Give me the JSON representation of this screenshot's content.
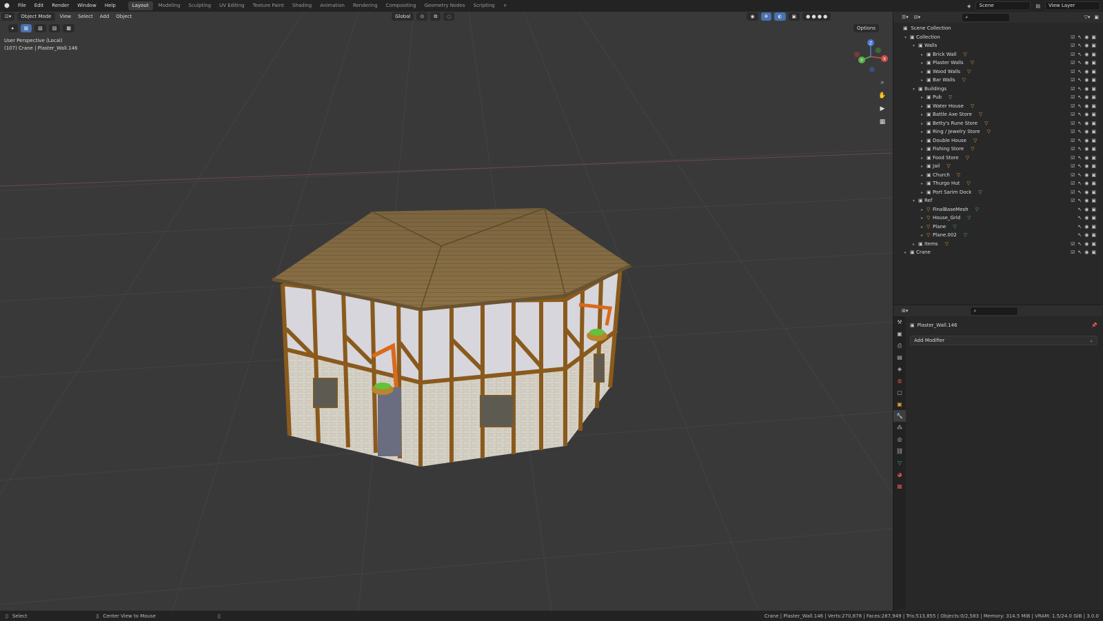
{
  "app": {
    "menu": [
      "File",
      "Edit",
      "Render",
      "Window",
      "Help"
    ],
    "workspaces": [
      "Layout",
      "Modeling",
      "Sculpting",
      "UV Editing",
      "Texture Paint",
      "Shading",
      "Animation",
      "Rendering",
      "Compositing",
      "Geometry Nodes",
      "Scripting",
      "+"
    ],
    "active_workspace": "Layout",
    "scene": "Scene",
    "view_layer": "View Layer"
  },
  "viewport": {
    "mode": "Object Mode",
    "menus": [
      "View",
      "Select",
      "Add",
      "Object"
    ],
    "orientation": "Global",
    "options_label": "Options",
    "overlay_line1": "User Perspective (Local)",
    "overlay_line2": "(107) Crane | Plaster_Wall.146",
    "axes": {
      "z": "Z",
      "x": "X",
      "y": "Y"
    }
  },
  "outliner": {
    "title": "Scene Collection",
    "rows": [
      {
        "name": "Collection",
        "depth": 1,
        "type": "collection",
        "open": true
      },
      {
        "name": "Walls",
        "depth": 2,
        "type": "collection",
        "open": true
      },
      {
        "name": "Brick Wall",
        "depth": 3,
        "type": "collection"
      },
      {
        "name": "Plaster Walls",
        "depth": 3,
        "type": "collection"
      },
      {
        "name": "Wood Walls",
        "depth": 3,
        "type": "collection"
      },
      {
        "name": "Bar Walls",
        "depth": 3,
        "type": "collection"
      },
      {
        "name": "Buildings",
        "depth": 2,
        "type": "collection",
        "open": true
      },
      {
        "name": "Pub",
        "depth": 3,
        "type": "collection"
      },
      {
        "name": "Water House",
        "depth": 3,
        "type": "collection"
      },
      {
        "name": "Battle Axe Store",
        "depth": 3,
        "type": "collection"
      },
      {
        "name": "Betty's Rune Store",
        "depth": 3,
        "type": "collection"
      },
      {
        "name": "Ring / Jewelry Store",
        "depth": 3,
        "type": "collection"
      },
      {
        "name": "Double House",
        "depth": 3,
        "type": "collection"
      },
      {
        "name": "Fishing Store",
        "depth": 3,
        "type": "collection"
      },
      {
        "name": "Food Store",
        "depth": 3,
        "type": "collection"
      },
      {
        "name": "Jail",
        "depth": 3,
        "type": "collection"
      },
      {
        "name": "Church",
        "depth": 3,
        "type": "collection"
      },
      {
        "name": "Thurgo Hut",
        "depth": 3,
        "type": "collection"
      },
      {
        "name": "Port Sarim Dock",
        "depth": 3,
        "type": "collection"
      },
      {
        "name": "Ref",
        "depth": 2,
        "type": "collection",
        "open": true
      },
      {
        "name": "FinalBaseMesh",
        "depth": 3,
        "type": "mesh"
      },
      {
        "name": "House_Grid",
        "depth": 3,
        "type": "mesh"
      },
      {
        "name": "Plane",
        "depth": 3,
        "type": "mesh"
      },
      {
        "name": "Plane.002",
        "depth": 3,
        "type": "mesh"
      },
      {
        "name": "Items",
        "depth": 2,
        "type": "collection"
      },
      {
        "name": "Crane",
        "depth": 1,
        "type": "collection"
      }
    ]
  },
  "properties": {
    "object_name": "Plaster_Wall.146",
    "add_modifier_label": "Add Modifier"
  },
  "statusbar": {
    "left_action": "Select",
    "middle_action": "Center View to Mouse",
    "stats": "Crane | Plaster_Wall.146 | Verts:270,878 | Faces:287,949 | Tris:513,855 | Objects:0/2,583 | Memory: 314.5 MiB | VRAM: 1.5/24.0 GiB | 3.0.0"
  },
  "colors": {
    "viewport_bg": "#393939",
    "panel_bg": "#282828",
    "mesh_icon": "#e59a3a",
    "mesh_icon_green": "#3fbf6a",
    "accent": "#4772b3"
  }
}
